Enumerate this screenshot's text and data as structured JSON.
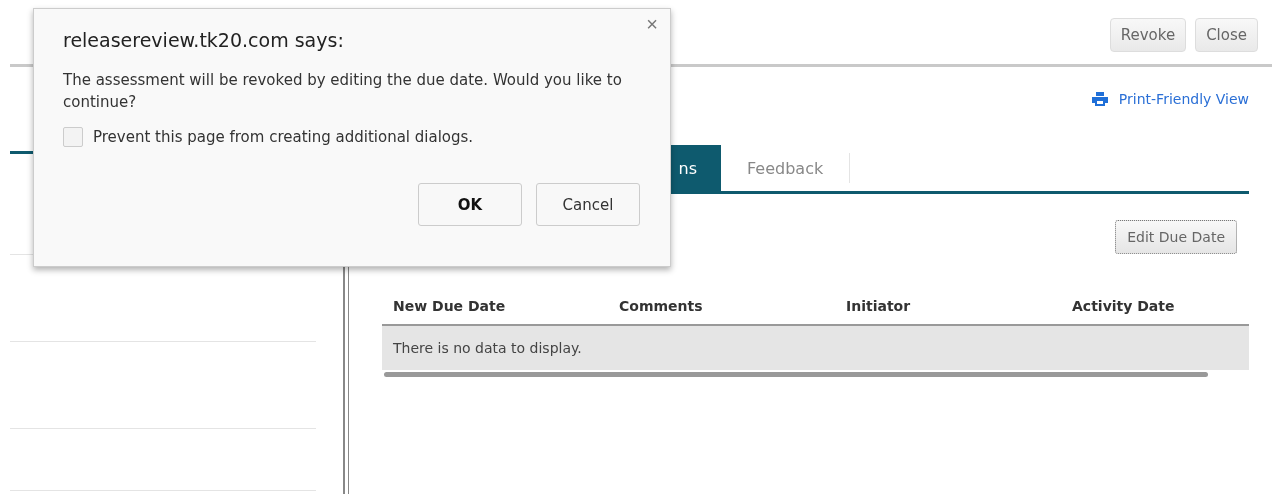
{
  "header": {
    "buttons": [
      "Revoke",
      "Close"
    ]
  },
  "print_link": "Print-Friendly View",
  "tabs": [
    {
      "label": "ns",
      "selected": true
    },
    {
      "label": "Feedback",
      "selected": false
    }
  ],
  "edit_button": "Edit Due Date",
  "table": {
    "columns": [
      "New Due Date",
      "Comments",
      "Initiator",
      "Activity Date"
    ],
    "empty_message": "There is no data to display."
  },
  "dialog": {
    "title": "releasereview.tk20.com says:",
    "message": "The assessment will be revoked by editing the due date. Would you like to continue?",
    "close": "×",
    "checkbox": {
      "label": "Prevent this page from creating additional dialogs.",
      "checked": false
    },
    "buttons": [
      "OK",
      "Cancel"
    ]
  }
}
